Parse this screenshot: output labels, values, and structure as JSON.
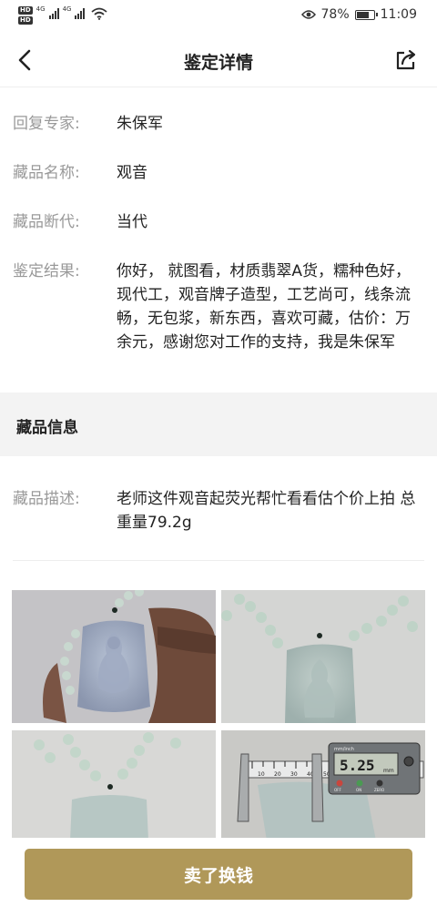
{
  "status_bar": {
    "hd_badge_1": "HD",
    "hd_badge_2": "HD",
    "network_1": "4G",
    "network_2": "4G",
    "battery_percent": "78%",
    "battery_level": 0.78,
    "time": "11:09"
  },
  "nav": {
    "title": "鉴定详情",
    "back_icon": "chevron-left-icon",
    "share_icon": "share-icon"
  },
  "appraisal": {
    "expert_label": "回复专家:",
    "expert_value": "朱保军",
    "name_label": "藏品名称:",
    "name_value": "观音",
    "era_label": "藏品断代:",
    "era_value": "当代",
    "result_label": "鉴定结果:",
    "result_value": "你好， 就图看，材质翡翠A货，糯种色好，现代工，观音牌子造型，工艺尚可，线条流畅，无包浆，新东西，喜欢可藏，估价：万余元，感谢您对工作的支持，我是朱保军"
  },
  "collection_info": {
    "section_title": "藏品信息",
    "desc_label": "藏品描述:",
    "desc_value": "老师这件观音起荧光帮忙看看估个价上拍 总重量79.2g"
  },
  "photos": {
    "caliper_reading": "5.25",
    "caliper_unit": "mm",
    "caliper_brand": "mm/inch",
    "caliper_off": "OFF",
    "caliper_on": "ON",
    "caliper_zero": "ZERO",
    "ruler_marks": [
      "10",
      "20",
      "30",
      "40",
      "50"
    ]
  },
  "footer": {
    "sell_button_label": "卖了换钱"
  },
  "colors": {
    "accent": "#b09859",
    "label_gray": "#999999",
    "section_bg": "#f3f3f3"
  }
}
